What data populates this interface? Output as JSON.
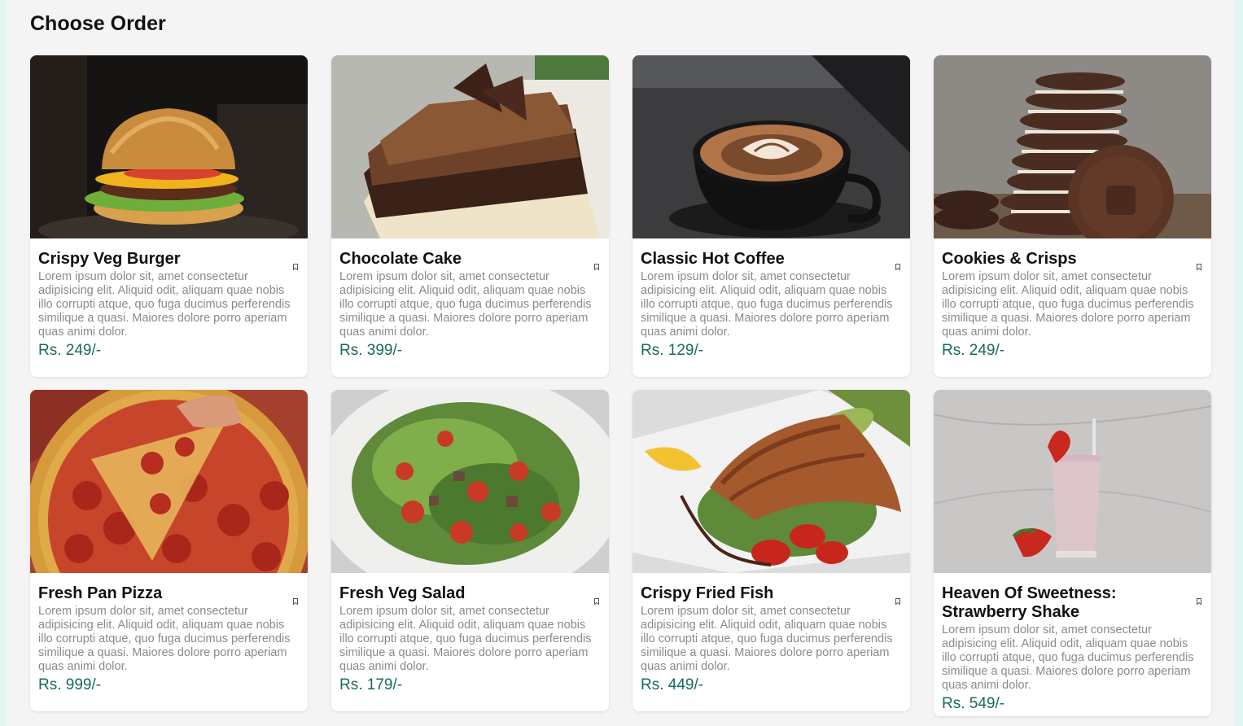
{
  "page": {
    "title": "Choose Order"
  },
  "items": [
    {
      "name": "Crispy Veg Burger",
      "description": "Lorem ipsum dolor sit, amet consectetur adipisicing elit. Aliquid odit, aliquam quae nobis illo corrupti atque, quo fuga ducimus perferendis similique a quasi. Maiores dolore porro aperiam quas animi dolor.",
      "price": "Rs. 249/-",
      "image": "burger-photo",
      "bookmark_icon": "bookmark-icon"
    },
    {
      "name": "Chocolate Cake",
      "description": "Lorem ipsum dolor sit, amet consectetur adipisicing elit. Aliquid odit, aliquam quae nobis illo corrupti atque, quo fuga ducimus perferendis similique a quasi. Maiores dolore porro aperiam quas animi dolor.",
      "price": "Rs. 399/-",
      "image": "cake-photo",
      "bookmark_icon": "bookmark-icon"
    },
    {
      "name": "Classic Hot Coffee",
      "description": "Lorem ipsum dolor sit, amet consectetur adipisicing elit. Aliquid odit, aliquam quae nobis illo corrupti atque, quo fuga ducimus perferendis similique a quasi. Maiores dolore porro aperiam quas animi dolor.",
      "price": "Rs. 129/-",
      "image": "coffee-photo",
      "bookmark_icon": "bookmark-icon"
    },
    {
      "name": "Cookies & Crisps",
      "description": "Lorem ipsum dolor sit, amet consectetur adipisicing elit. Aliquid odit, aliquam quae nobis illo corrupti atque, quo fuga ducimus perferendis similique a quasi. Maiores dolore porro aperiam quas animi dolor.",
      "price": "Rs. 249/-",
      "image": "cookies-photo",
      "bookmark_icon": "bookmark-icon"
    },
    {
      "name": "Fresh Pan Pizza",
      "description": "Lorem ipsum dolor sit, amet consectetur adipisicing elit. Aliquid odit, aliquam quae nobis illo corrupti atque, quo fuga ducimus perferendis similique a quasi. Maiores dolore porro aperiam quas animi dolor.",
      "price": "Rs. 999/-",
      "image": "pizza-photo",
      "bookmark_icon": "bookmark-icon"
    },
    {
      "name": "Fresh Veg Salad",
      "description": "Lorem ipsum dolor sit, amet consectetur adipisicing elit. Aliquid odit, aliquam quae nobis illo corrupti atque, quo fuga ducimus perferendis similique a quasi. Maiores dolore porro aperiam quas animi dolor.",
      "price": "Rs. 179/-",
      "image": "salad-photo",
      "bookmark_icon": "bookmark-icon"
    },
    {
      "name": "Crispy Fried Fish",
      "description": "Lorem ipsum dolor sit, amet consectetur adipisicing elit. Aliquid odit, aliquam quae nobis illo corrupti atque, quo fuga ducimus perferendis similique a quasi. Maiores dolore porro aperiam quas animi dolor.",
      "price": "Rs. 449/-",
      "image": "fish-photo",
      "bookmark_icon": "bookmark-icon"
    },
    {
      "name": "Heaven Of Sweetness: Strawberry Shake",
      "description": "Lorem ipsum dolor sit, amet consectetur adipisicing elit. Aliquid odit, aliquam quae nobis illo corrupti atque, quo fuga ducimus perferendis similique a quasi. Maiores dolore porro aperiam quas animi dolor.",
      "price": "Rs. 549/-",
      "image": "strawberry-shake-photo",
      "bookmark_icon": "bookmark-icon"
    }
  ],
  "colors": {
    "price": "#176b5a",
    "description": "#8a8a8a",
    "page_background": "#f4f4f4"
  }
}
